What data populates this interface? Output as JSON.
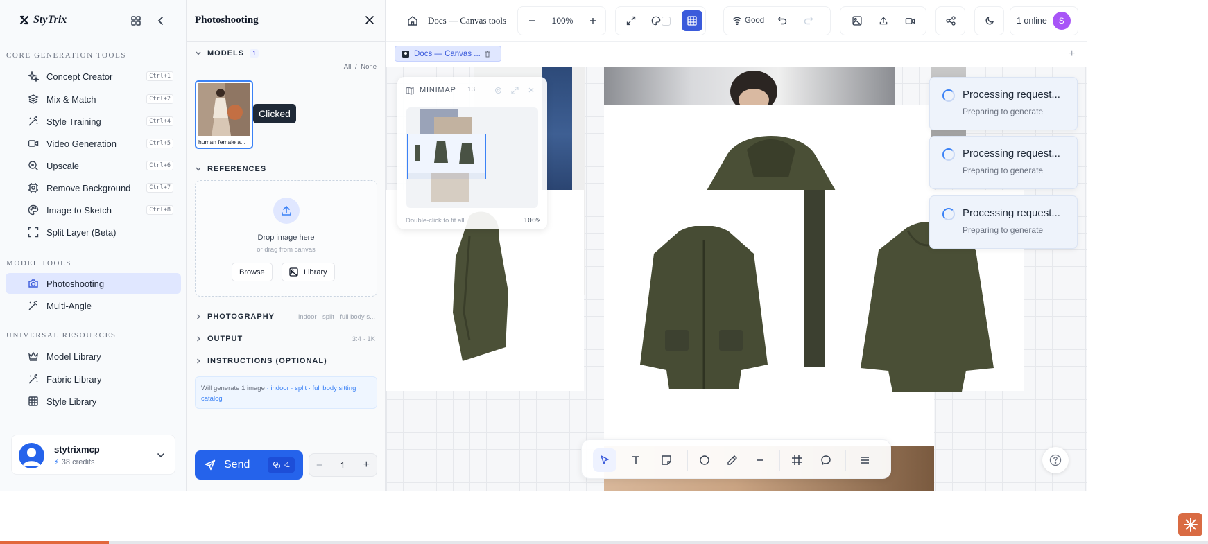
{
  "sidebar": {
    "brand": "StyTrix",
    "sections": {
      "core": "CORE GENERATION TOOLS",
      "model": "MODEL TOOLS",
      "resources": "UNIVERSAL RESOURCES"
    },
    "core_items": [
      {
        "label": "Concept Creator",
        "shortcut": "Ctrl+1",
        "icon": "sparkles-icon"
      },
      {
        "label": "Mix & Match",
        "shortcut": "Ctrl+2",
        "icon": "layers-icon"
      },
      {
        "label": "Style Training",
        "shortcut": "Ctrl+4",
        "icon": "wand-icon"
      },
      {
        "label": "Video Generation",
        "shortcut": "Ctrl+5",
        "icon": "video-icon"
      },
      {
        "label": "Upscale",
        "shortcut": "Ctrl+6",
        "icon": "zoom-in-icon"
      },
      {
        "label": "Remove Background",
        "shortcut": "Ctrl+7",
        "icon": "background-remove-icon"
      },
      {
        "label": "Image to Sketch",
        "shortcut": "Ctrl+8",
        "icon": "palette-icon"
      },
      {
        "label": "Split Layer (Beta)",
        "shortcut": "",
        "icon": "scan-icon"
      }
    ],
    "model_items": [
      {
        "label": "Photoshooting",
        "icon": "camera-icon",
        "active": true
      },
      {
        "label": "Multi-Angle",
        "icon": "wand-icon",
        "active": false
      }
    ],
    "resource_items": [
      {
        "label": "Model Library",
        "icon": "crown-icon"
      },
      {
        "label": "Fabric Library",
        "icon": "wand-icon"
      },
      {
        "label": "Style Library",
        "icon": "grid-icon"
      }
    ],
    "user": {
      "name": "stytrixmcp",
      "credits": "38 credits"
    }
  },
  "panel": {
    "title": "Photoshooting",
    "models": {
      "label": "MODELS",
      "count": "1",
      "all": "All",
      "sep": "/",
      "none": "None",
      "card_label": "human female a...",
      "tooltip": "Clicked"
    },
    "references": {
      "label": "REFERENCES",
      "drop_title": "Drop image here",
      "drop_sub": "or drag from canvas",
      "browse": "Browse",
      "library": "Library"
    },
    "photography": {
      "label": "PHOTOGRAPHY",
      "meta": "indoor · split · full body s..."
    },
    "output": {
      "label": "OUTPUT",
      "meta": "3:4 · 1K"
    },
    "instructions": {
      "label": "INSTRUCTIONS (OPTIONAL)"
    },
    "summary": {
      "lead": "Will generate 1 image",
      "tags": " · indoor · split · full body sitting · catalog"
    },
    "send": {
      "label": "Send",
      "cost": "-1"
    },
    "quantity": "1"
  },
  "topbar": {
    "doc_title": "Docs — Canvas tools",
    "zoom": "100%",
    "connection": "Good",
    "online": "1 online",
    "online_initial": "S"
  },
  "tabs": [
    {
      "label": "Docs — Canvas ..."
    }
  ],
  "minimap": {
    "title": "MINIMAP",
    "count": "13",
    "hint": "Double-click to fit all",
    "zoom": "100%"
  },
  "toasts": [
    {
      "title": "Processing request...",
      "sub": "Preparing to generate"
    },
    {
      "title": "Processing request...",
      "sub": "Preparing to generate"
    },
    {
      "title": "Processing request...",
      "sub": "Preparing to generate"
    }
  ],
  "progress": {
    "fraction": 0.09
  },
  "colors": {
    "accent": "#3b5bdb",
    "send": "#2563eb",
    "active_nav": "#e0e7ff",
    "jacket": "#4a4f36",
    "brand_corner": "#d96b43"
  }
}
